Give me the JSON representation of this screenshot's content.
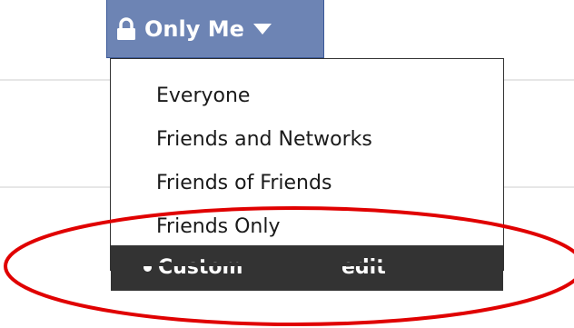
{
  "privacy_button": {
    "label": "Only Me",
    "lock_icon": "lock-icon",
    "arrow_icon": "dropdown-arrow-icon",
    "background": "#6d84b4"
  },
  "menu": {
    "items": [
      {
        "label": "Everyone"
      },
      {
        "label": "Friends and Networks"
      },
      {
        "label": "Friends of Friends"
      },
      {
        "label": "Friends Only"
      }
    ],
    "selected": {
      "label": "Custom",
      "edit_label": "edit",
      "bullet_icon": "bullet-icon",
      "background": "#333333"
    }
  },
  "annotation": {
    "shape": "ellipse",
    "color": "#e00000"
  }
}
